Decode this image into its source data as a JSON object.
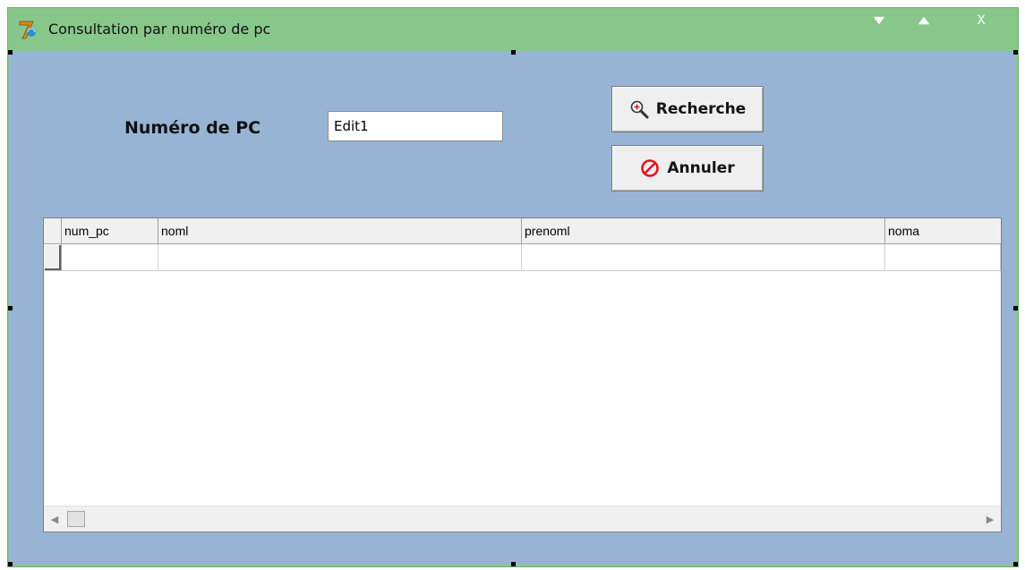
{
  "window": {
    "title": "Consultation par numéro de pc",
    "titlebar_buttons": {
      "minimize_icon": "triangle-down-icon",
      "maximize_icon": "triangle-up-icon",
      "close_label": "X"
    }
  },
  "form": {
    "label": "Numéro de PC",
    "edit_value": "Edit1"
  },
  "buttons": {
    "search_label": "Recherche",
    "search_icon": "magnifier-plus-icon",
    "cancel_label": "Annuler",
    "cancel_icon": "prohibited-icon",
    "cancel_icon_color": "#e8101a"
  },
  "grid": {
    "columns": [
      "num_pc",
      "noml",
      "prenoml",
      "noma"
    ],
    "rows": [
      [
        "",
        "",
        "",
        ""
      ]
    ]
  },
  "colors": {
    "frame": "#88c78a",
    "client": "#98b4d4"
  }
}
